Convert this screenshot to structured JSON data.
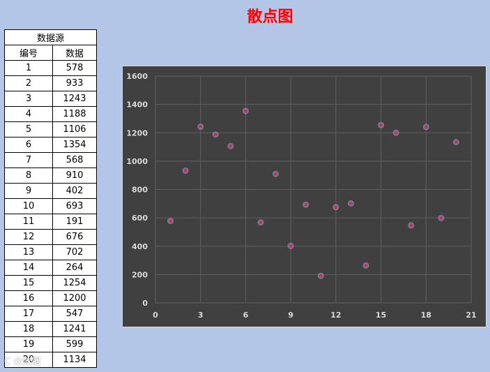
{
  "title": "散点图",
  "table": {
    "header": "数据源",
    "col_labels": [
      "编号",
      "数据"
    ],
    "rows": [
      [
        "1",
        "578"
      ],
      [
        "2",
        "933"
      ],
      [
        "3",
        "1243"
      ],
      [
        "4",
        "1188"
      ],
      [
        "5",
        "1106"
      ],
      [
        "6",
        "1354"
      ],
      [
        "7",
        "568"
      ],
      [
        "8",
        "910"
      ],
      [
        "9",
        "402"
      ],
      [
        "10",
        "693"
      ],
      [
        "11",
        "191"
      ],
      [
        "12",
        "676"
      ],
      [
        "13",
        "702"
      ],
      [
        "14",
        "264"
      ],
      [
        "15",
        "1254"
      ],
      [
        "16",
        "1200"
      ],
      [
        "17",
        "547"
      ],
      [
        "18",
        "1241"
      ],
      [
        "19",
        "599"
      ],
      [
        "20",
        "1134"
      ]
    ]
  },
  "watermark": "C 众数据",
  "chart_data": {
    "type": "scatter",
    "x": [
      1,
      2,
      3,
      4,
      5,
      6,
      7,
      8,
      9,
      10,
      11,
      12,
      13,
      14,
      15,
      16,
      17,
      18,
      19,
      20
    ],
    "y": [
      578,
      933,
      1243,
      1188,
      1106,
      1354,
      568,
      910,
      402,
      693,
      191,
      676,
      702,
      264,
      1254,
      1200,
      547,
      1241,
      599,
      1134
    ],
    "xlim": [
      0,
      21
    ],
    "ylim": [
      0,
      1600
    ],
    "xticks": [
      0,
      3,
      6,
      9,
      12,
      15,
      18,
      21
    ],
    "yticks": [
      0,
      200,
      400,
      600,
      800,
      1000,
      1200,
      1400,
      1600
    ],
    "grid": true,
    "marker_color": "#c0306a",
    "background_color": "#404040",
    "grid_color": "#5f5f5f"
  }
}
